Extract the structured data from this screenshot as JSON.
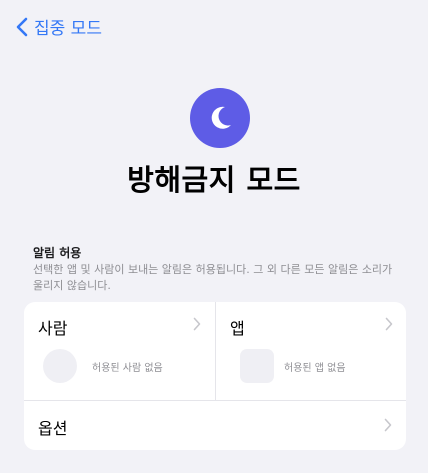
{
  "nav": {
    "back_label": "집중 모드"
  },
  "header": {
    "title": "방해금지 모드",
    "icon": "moon-icon",
    "icon_color": "#5e5ce6"
  },
  "allowed_notifications": {
    "header": "알림 허용",
    "description": "선택한 앱 및 사람이 보내는 알림은 허용됩니다. 그 외 다른 모든 알림은 소리가 울리지 않습니다."
  },
  "people": {
    "label": "사람",
    "empty_text": "허용된 사람 없음"
  },
  "apps": {
    "label": "앱",
    "empty_text": "허용된 앱 없음"
  },
  "options": {
    "label": "옵션"
  },
  "colors": {
    "accent": "#3478f6",
    "background": "#f2f2f7"
  }
}
